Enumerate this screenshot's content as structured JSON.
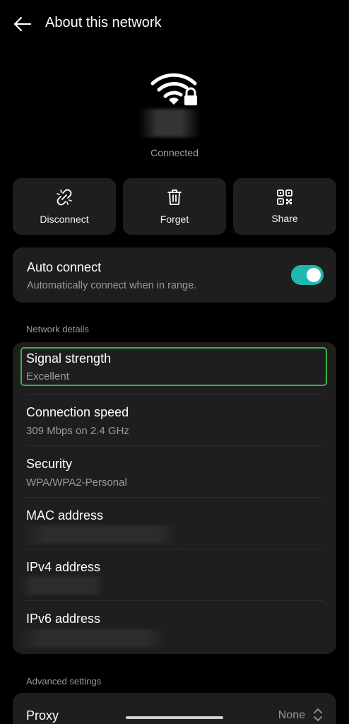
{
  "header": {
    "title": "About this network"
  },
  "network": {
    "status": "Connected"
  },
  "actions": [
    {
      "label": "Disconnect",
      "icon": "link-broken-icon"
    },
    {
      "label": "Forget",
      "icon": "trash-icon"
    },
    {
      "label": "Share",
      "icon": "qr-code-icon"
    }
  ],
  "auto_connect": {
    "title": "Auto connect",
    "subtitle": "Automatically connect when in range.",
    "enabled": true,
    "accent": "#1fb8b0"
  },
  "sections": {
    "details": "Network details",
    "advanced": "Advanced settings"
  },
  "details": [
    {
      "title": "Signal strength",
      "value": "Excellent"
    },
    {
      "title": "Connection speed",
      "value": "309 Mbps on 2.4 GHz"
    },
    {
      "title": "Security",
      "value": "WPA/WPA2-Personal"
    },
    {
      "title": "MAC address",
      "value": ""
    },
    {
      "title": "IPv4 address",
      "value": ""
    },
    {
      "title": "IPv6 address",
      "value": ""
    }
  ],
  "proxy": {
    "title": "Proxy",
    "value": "None"
  },
  "colors": {
    "background": "#000000",
    "card": "#1e1e1e",
    "focus_outline": "#3fae4a"
  }
}
